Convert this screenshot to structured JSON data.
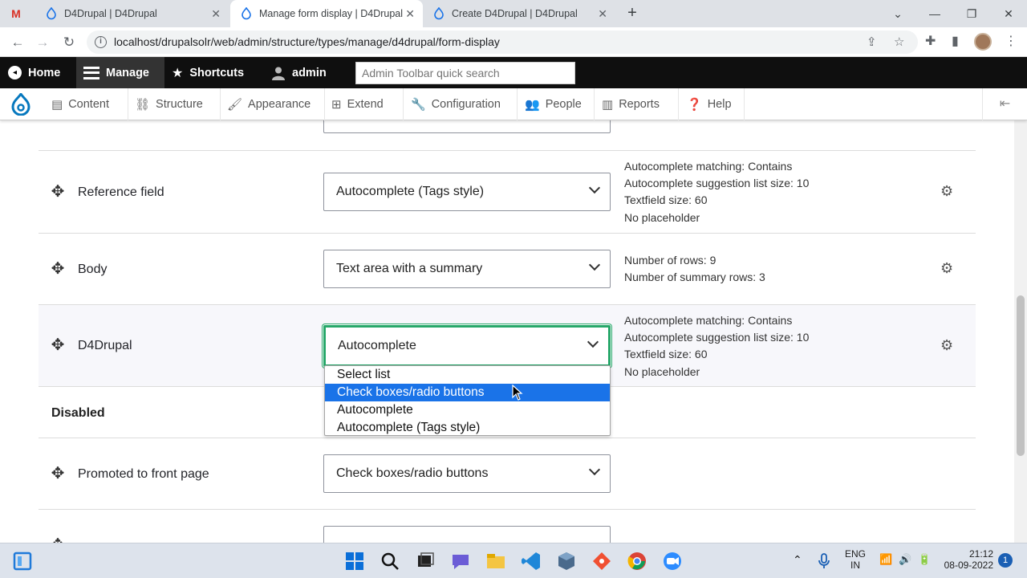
{
  "browser": {
    "tabs": [
      {
        "title": "D4Drupal | D4Drupal",
        "close": "✕"
      },
      {
        "title": "Manage form display | D4Drupal",
        "close": "✕"
      },
      {
        "title": "Create D4Drupal | D4Drupal",
        "close": "✕"
      }
    ],
    "new_tab": "+",
    "url": "localhost/drupalsolr/web/admin/structure/types/manage/d4drupal/form-display"
  },
  "admin_toolbar": {
    "home": "Home",
    "manage": "Manage",
    "shortcuts": "Shortcuts",
    "user": "admin",
    "search_placeholder": "Admin Toolbar quick search"
  },
  "admin_menu": {
    "items": [
      "Content",
      "Structure",
      "Appearance",
      "Extend",
      "Configuration",
      "People",
      "Reports",
      "Help"
    ]
  },
  "form_display": {
    "rows": [
      {
        "label": "Reference field",
        "widget": "Autocomplete (Tags style)",
        "summary": [
          "Autocomplete matching: Contains",
          "Autocomplete suggestion list size: 10",
          "Textfield size: 60",
          "No placeholder"
        ]
      },
      {
        "label": "Body",
        "widget": "Text area with a summary",
        "summary": [
          "Number of rows: 9",
          "Number of summary rows: 3"
        ]
      },
      {
        "label": "D4Drupal",
        "widget": "Autocomplete",
        "summary": [
          "Autocomplete matching: Contains",
          "Autocomplete suggestion list size: 10",
          "Textfield size: 60",
          "No placeholder"
        ]
      }
    ],
    "dropdown_options": [
      "Select list",
      "Check boxes/radio buttons",
      "Autocomplete",
      "Autocomplete (Tags style)"
    ],
    "dropdown_highlighted": "Check boxes/radio buttons",
    "disabled_heading": "Disabled",
    "disabled_rows": [
      {
        "label": "Promoted to front page",
        "widget": "Check boxes/radio buttons"
      }
    ]
  },
  "taskbar": {
    "lang_top": "ENG",
    "lang_bottom": "IN",
    "time": "21:12",
    "date": "08-09-2022",
    "notifications": "1"
  }
}
